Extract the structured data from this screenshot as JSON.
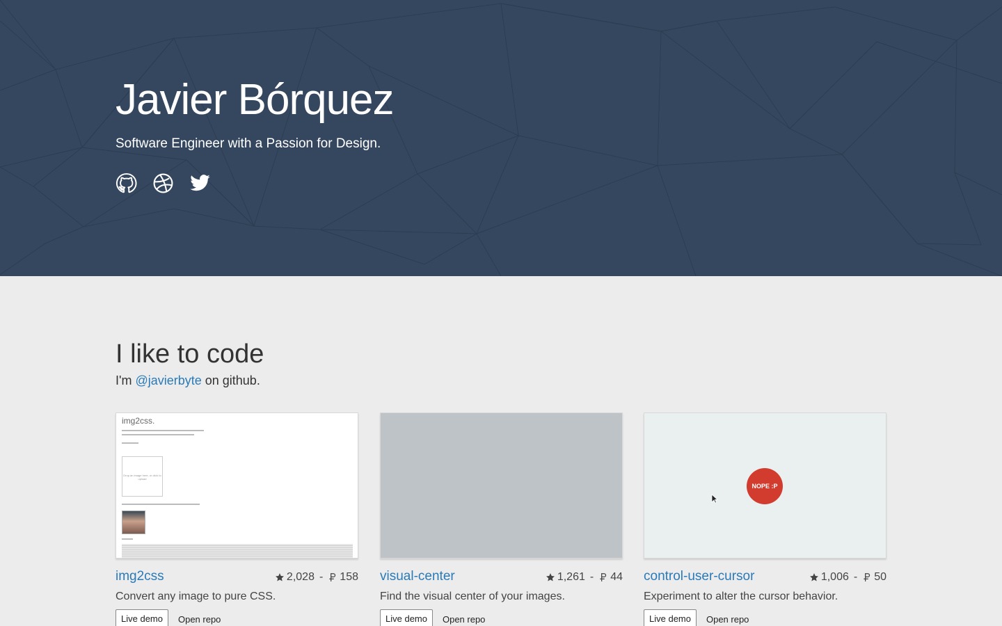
{
  "hero": {
    "title": "Javier Bórquez",
    "subtitle": "Software Engineer with a Passion for Design.",
    "social": [
      "github-icon",
      "dribbble-icon",
      "twitter-icon"
    ]
  },
  "section": {
    "title": "I like to code",
    "sub_prefix": "I'm ",
    "sub_link": "@javierbyte",
    "sub_suffix": " on github."
  },
  "projects": [
    {
      "name": "img2css",
      "stars": "2,028",
      "separator": "-",
      "forks": "158",
      "description": "Convert any image to pure CSS.",
      "demo_label": "Live demo",
      "repo_label": "Open repo",
      "preview": {
        "title": "img2css.",
        "drop_text": "Drop an image here, or click to upload"
      }
    },
    {
      "name": "visual-center",
      "stars": "1,261",
      "separator": "-",
      "forks": "44",
      "description": "Find the visual center of your images.",
      "demo_label": "Live demo",
      "repo_label": "Open repo"
    },
    {
      "name": "control-user-cursor",
      "stars": "1,006",
      "separator": "-",
      "forks": "50",
      "description": "Experiment to alter the cursor behavior.",
      "demo_label": "Live demo",
      "repo_label": "Open repo",
      "preview": {
        "badge": "NOPE :P"
      }
    }
  ],
  "colors": {
    "hero_bg": "#35475f",
    "page_bg": "#ececec",
    "link": "#2a7ab8",
    "badge": "#d13c2f"
  }
}
